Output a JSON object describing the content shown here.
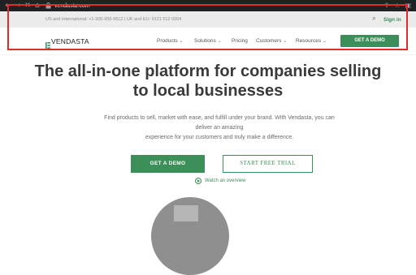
{
  "browser": {
    "url": "vendasta.com",
    "back_icon": "arrow-left",
    "forward_icon": "arrow-right",
    "reload_icon": "close-x",
    "home_icon": "home",
    "lock_icon": "lock"
  },
  "topbar": {
    "phone": "US and International: +1-306-955-5512 | UK and EU: 0121 512 0304",
    "signin": "Sign in"
  },
  "nav": {
    "logo_text": "VENDASTA",
    "items": [
      {
        "label": "Products",
        "has_dropdown": true
      },
      {
        "label": "Solutions",
        "has_dropdown": true
      },
      {
        "label": "Pricing",
        "has_dropdown": false
      },
      {
        "label": "Customers",
        "has_dropdown": true
      },
      {
        "label": "Resources",
        "has_dropdown": true
      }
    ],
    "cta": "GET A DEMO"
  },
  "hero": {
    "headline_line1": "The all-in-one platform for companies selling",
    "headline_line2": "to local businesses",
    "sub_line1": "Find products to sell, market with ease, and fulfill under your brand. With Vendasta, you can deliver an amazing",
    "sub_line2": "experience for your customers and truly make a difference.",
    "primary_cta": "GET A DEMO",
    "secondary_cta": "START FREE TRIAL",
    "watch_label": "Watch an overview"
  },
  "colors": {
    "brand_green": "#3c8f59",
    "highlight_red": "#e02b2b"
  }
}
